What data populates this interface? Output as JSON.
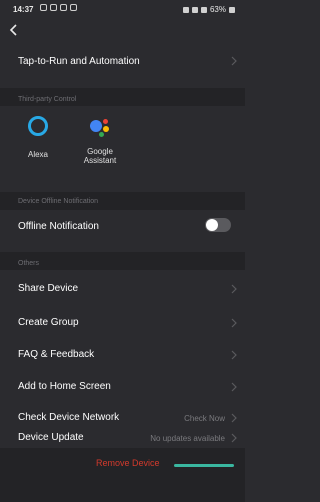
{
  "status_bar": {
    "time": "14:37",
    "battery": "63%"
  },
  "rows": {
    "tap_to_run": "Tap-to-Run and Automation",
    "offline_notification": "Offline Notification",
    "share_device": "Share Device",
    "create_group": "Create Group",
    "faq_feedback": "FAQ & Feedback",
    "add_home": "Add to Home Screen",
    "check_network": "Check Device Network",
    "check_network_value": "Check Now",
    "device_update": "Device Update",
    "device_update_value": "No updates available"
  },
  "sections": {
    "third_party": "Third-party Control",
    "offline": "Device Offline Notification",
    "others": "Others"
  },
  "assistants": [
    {
      "name": "Alexa"
    },
    {
      "name": "Google Assistant",
      "line1": "Google",
      "line2": "Assistant"
    }
  ],
  "offline_toggle": {
    "on": false
  },
  "remove": {
    "label": "Remove Device"
  },
  "colors": {
    "accent_red": "#d33a2c",
    "alexa_blue": "#28a9e6",
    "bar_teal": "#3ab7a0"
  }
}
